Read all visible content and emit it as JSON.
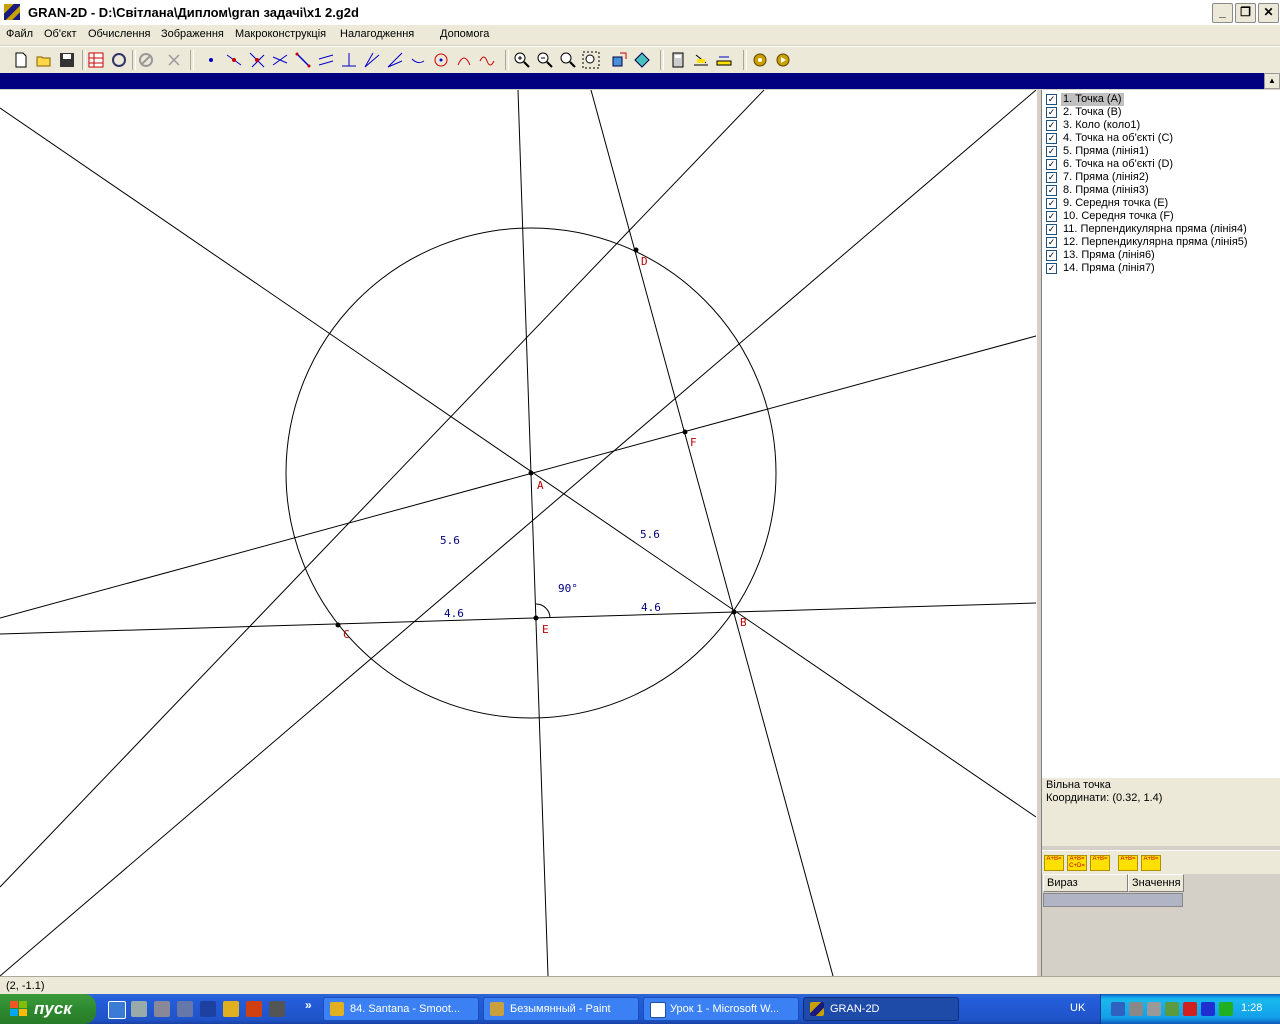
{
  "window": {
    "title": "GRAN-2D - D:\\Світлана\\Диплом\\gran задачі\\x1  2.g2d",
    "minimize": "_",
    "restore": "❐",
    "close": "✕"
  },
  "menu": [
    "Файл",
    "Об'єкт",
    "Обчислення",
    "Зображення",
    "Макроконструкція",
    "Налагодження",
    "Допомога"
  ],
  "toolbar_icons": [
    "new-file-icon",
    "open-folder-icon",
    "save-icon",
    "table-icon",
    "refresh-icon",
    "disabled-icon",
    "cut-icon",
    "point-icon",
    "point-on-line-icon",
    "intersection-icon",
    "crossing-lines-icon",
    "segment-icon",
    "parallel-icon",
    "perpendicular-icon",
    "angle-icon",
    "bisector-icon",
    "vector-icon",
    "circle-icon",
    "arc-icon",
    "curve-icon",
    "zoom-in-icon",
    "zoom-out-icon",
    "zoom-fit-icon",
    "zoom-window-icon",
    "move-icon",
    "rotate-icon",
    "calculator-icon",
    "measure-icon",
    "ruler-icon",
    "macro-icon",
    "macro-run-icon"
  ],
  "objects": [
    {
      "label": "1. Точка (A)",
      "checked": true,
      "selected": true
    },
    {
      "label": "2. Точка (B)",
      "checked": true
    },
    {
      "label": "3. Коло (коло1)",
      "checked": true
    },
    {
      "label": "4. Точка на об'єкті (C)",
      "checked": true
    },
    {
      "label": "5. Пряма (лінія1)",
      "checked": true
    },
    {
      "label": "6. Точка на об'єкті (D)",
      "checked": true
    },
    {
      "label": "7. Пряма (лінія2)",
      "checked": true
    },
    {
      "label": "8. Пряма (лінія3)",
      "checked": true
    },
    {
      "label": "9. Середня точка (E)",
      "checked": true
    },
    {
      "label": "10. Середня точка (F)",
      "checked": true
    },
    {
      "label": "11. Перпендикулярна пряма (лінія4)",
      "checked": true
    },
    {
      "label": "12. Перпендикулярна пряма (лінія5)",
      "checked": true
    },
    {
      "label": "13. Пряма (лінія6)",
      "checked": true
    },
    {
      "label": "14. Пряма (лінія7)",
      "checked": true
    }
  ],
  "info": {
    "line1": "Вільна точка",
    "line2": "Координати: (0.32, 1.4)"
  },
  "expr_table": {
    "col1": "Вираз",
    "col2": "Значення"
  },
  "expr_tools": [
    "A+B=",
    "A+B= C+D=",
    "A+B=",
    "A+B=",
    "A+B="
  ],
  "status": "(2, -1.1)",
  "drawing": {
    "point_labels": {
      "A": "A",
      "B": "B",
      "C": "C",
      "D": "D",
      "E": "E",
      "F": "F"
    },
    "measures": {
      "ca": "5.6",
      "ab": "5.6",
      "ce": "4.6",
      "eb": "4.6",
      "angle": "90°"
    },
    "label_color": "#c00000",
    "measure_color": "#000080"
  },
  "taskbar": {
    "start": "пуск",
    "tasks": [
      {
        "label": "84. Santana - Smoot...",
        "active": false
      },
      {
        "label": "Безымянный - Paint",
        "active": false
      },
      {
        "label": "Урок 1 - Microsoft W...",
        "active": false
      },
      {
        "label": "GRAN-2D",
        "active": true
      }
    ],
    "lang": "UK",
    "clock": "1:28",
    "more": "»"
  }
}
